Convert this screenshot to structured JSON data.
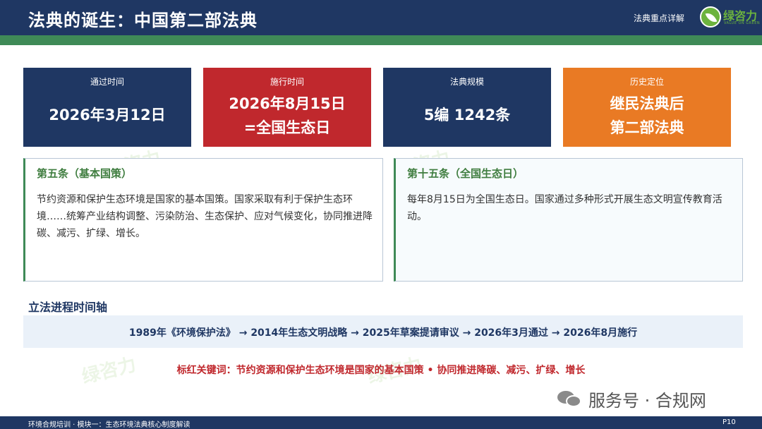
{
  "header": {
    "title": "法典的诞生：中国第二部法典",
    "subtitle": "法典重点详解",
    "logo_text": "绿咨力",
    "logo_subtext": "VALUE ON GREEN"
  },
  "cards": [
    {
      "label": "通过时间",
      "value_lines": [
        "2026年3月12日"
      ],
      "color": "#1f3763"
    },
    {
      "label": "施行时间",
      "value_lines": [
        "2026年8月15日",
        "=全国生态日"
      ],
      "color": "#c0282d"
    },
    {
      "label": "法典规模",
      "value_lines": [
        "5编 1242条"
      ],
      "color": "#1f3763"
    },
    {
      "label": "历史定位",
      "value_lines": [
        "继民法典后",
        "第二部法典"
      ],
      "color": "#e97a24"
    }
  ],
  "articles": [
    {
      "title": "第五条（基本国策）",
      "text": "节约资源和保护生态环境是国家的基本国策。国家采取有利于保护生态环境……统筹产业结构调整、污染防治、生态保护、应对气候变化，协同推进降碳、减污、扩绿、增长。"
    },
    {
      "title": "第十五条（全国生态日）",
      "text": "每年8月15日为全国生态日。国家通过多种形式开展生态文明宣传教育活动。"
    }
  ],
  "timeline": {
    "title": "立法进程时间轴",
    "text": "1989年《环境保护法》 → 2014年生态文明战略 → 2025年草案提请审议 → 2026年3月通过 → 2026年8月施行"
  },
  "keywords": "标红关键词：节约资源和保护生态环境是国家的基本国策 • 协同推进降碳、减污、扩绿、增长",
  "watermark": {
    "text": "绿咨力"
  },
  "service_account": "服务号 · 合规网",
  "footer": {
    "left": "环境合规培训 · 模块一：生态环境法典核心制度解读",
    "page": "P10"
  },
  "colors": {
    "navy": "#1f3763",
    "green": "#3f8a57",
    "red": "#c0282d",
    "orange": "#e97a24",
    "brand_green": "#6cb33e"
  }
}
